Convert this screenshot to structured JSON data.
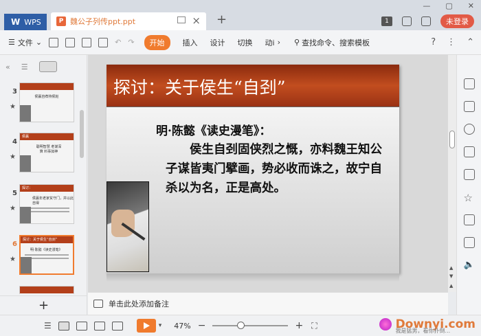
{
  "titlebar": {
    "wps_label": "WPS",
    "doc_tab_icon": "P",
    "doc_tab_name": "魏公子列传ppt.ppt",
    "new_tab": "+",
    "page_count_badge": "1",
    "login_label": "未登录",
    "close_tab": "×"
  },
  "ribbon": {
    "file_label": "文件",
    "tabs": [
      "开始",
      "插入",
      "设计",
      "切换",
      "动i"
    ],
    "search_label": "查找命令、搜索模板",
    "help": "?"
  },
  "left_panel": {
    "slides": [
      {
        "num": "3",
        "bar_text": "",
        "text": "侯嬴自荐持侯赵"
      },
      {
        "num": "4",
        "bar_text": "侯嬴",
        "text": "聪明智慧 老谋深算 料事如神"
      },
      {
        "num": "5",
        "bar_text": "探讨：",
        "text": "侯嬴年老家贫守门，并以此自得"
      },
      {
        "num": "6",
        "bar_text": "探讨：关于侯生“自刭”",
        "text": "明·陈懿《读史漫笔》"
      }
    ],
    "add_slide": "+"
  },
  "slide": {
    "title": "探讨：关于侯生“自刭”",
    "subtitle": "明·陈懿《读史漫笔》：",
    "body": "侯生自刭固侠烈之慨，亦料魏王知公子谋皆夷门擘画，势必收而诛之，故宁自杀以为名，正是高处。"
  },
  "notes": {
    "placeholder": "单击此处添加备注"
  },
  "status": {
    "zoom": "47%",
    "minus": "−",
    "plus": "+",
    "watermark": "Downyi.com",
    "watermark_sub": "我是猛男，看你扑倒..."
  }
}
